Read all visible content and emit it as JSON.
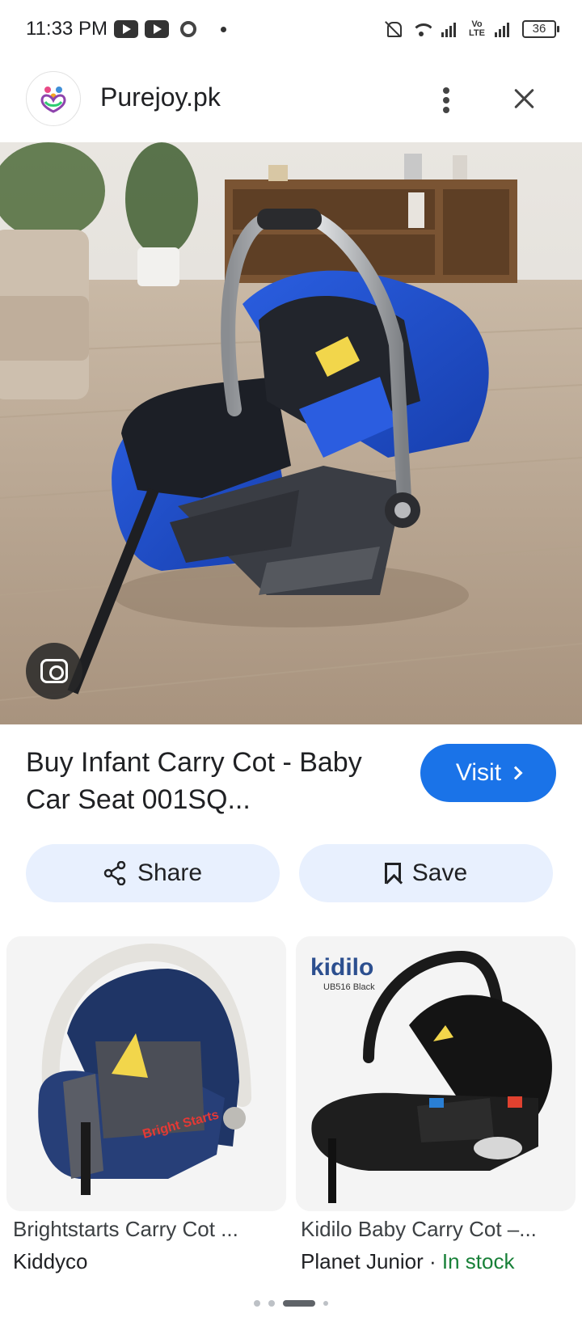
{
  "status_bar": {
    "time": "11:33 PM",
    "battery": "36",
    "network_label": "Vo LTE"
  },
  "header": {
    "site_name": "Purejoy.pk"
  },
  "result": {
    "title": "Buy Infant Carry Cot - Baby Car Seat 001SQ...",
    "visit_label": "Visit",
    "share_label": "Share",
    "save_label": "Save"
  },
  "related": [
    {
      "title": "Brightstarts Carry Cot ...",
      "source": "Kiddyco",
      "brand_text": "Bright Starts"
    },
    {
      "title": "Kidilo Baby Carry Cot –...",
      "source": "Planet Junior",
      "separator": " · ",
      "availability": "In stock",
      "brand_text": "kidilo",
      "model_text": "UB516 Black"
    }
  ],
  "colors": {
    "accent": "#1a73e8",
    "chip_bg": "#e8f0fe",
    "in_stock": "#188038"
  },
  "pager": {
    "active_index": 2,
    "count": 4
  }
}
